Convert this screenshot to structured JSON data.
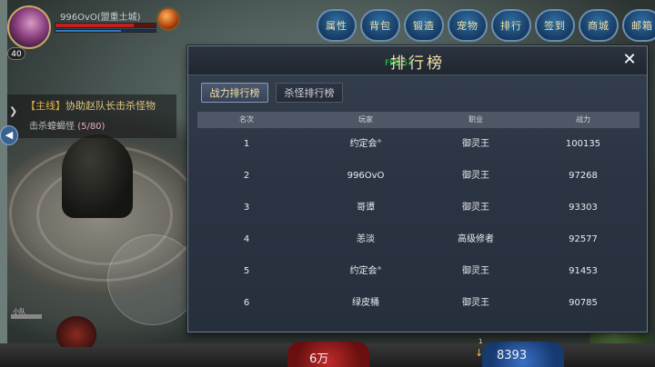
{
  "hud": {
    "player_name": "996OvO(盟重土城)",
    "level": "40",
    "hp_fraction": 0.78,
    "mp_fraction": 0.65
  },
  "top_menu": [
    "属性",
    "背包",
    "锻造",
    "宠物",
    "排行",
    "签到",
    "商城",
    "邮箱"
  ],
  "quest": {
    "title_tag": "【主线】",
    "title_text": "协助赵队长击杀怪物",
    "sub_text": "击杀蝗蝎怪",
    "sub_count": "(5/80)"
  },
  "bottom": {
    "left_value": "6万",
    "right_value": "8393",
    "small_badge": "1",
    "small_label": "小队"
  },
  "rank_panel": {
    "title": "排行榜",
    "fps_text": "FPS:57",
    "close_glyph": "✕",
    "tabs": [
      {
        "label": "战力排行榜",
        "active": true
      },
      {
        "label": "杀怪排行榜",
        "active": false
      }
    ],
    "columns": [
      "名次",
      "玩家",
      "职业",
      "战力"
    ],
    "rows": [
      {
        "rank": "1",
        "player": "约定会°",
        "job": "御灵王",
        "power": "100135"
      },
      {
        "rank": "2",
        "player": "996OvO",
        "job": "御灵王",
        "power": "97268"
      },
      {
        "rank": "3",
        "player": "哥谭",
        "job": "御灵王",
        "power": "93303"
      },
      {
        "rank": "4",
        "player": "恙淡",
        "job": "高级修者",
        "power": "92577"
      },
      {
        "rank": "5",
        "player": "约定会°",
        "job": "御灵王",
        "power": "91453"
      },
      {
        "rank": "6",
        "player": "绿皮桶",
        "job": "御灵王",
        "power": "90785"
      }
    ]
  },
  "colors": {
    "title_gold": "#f4e2aa",
    "fps_green": "#31d04a",
    "panel_bg": "#2c3544"
  }
}
